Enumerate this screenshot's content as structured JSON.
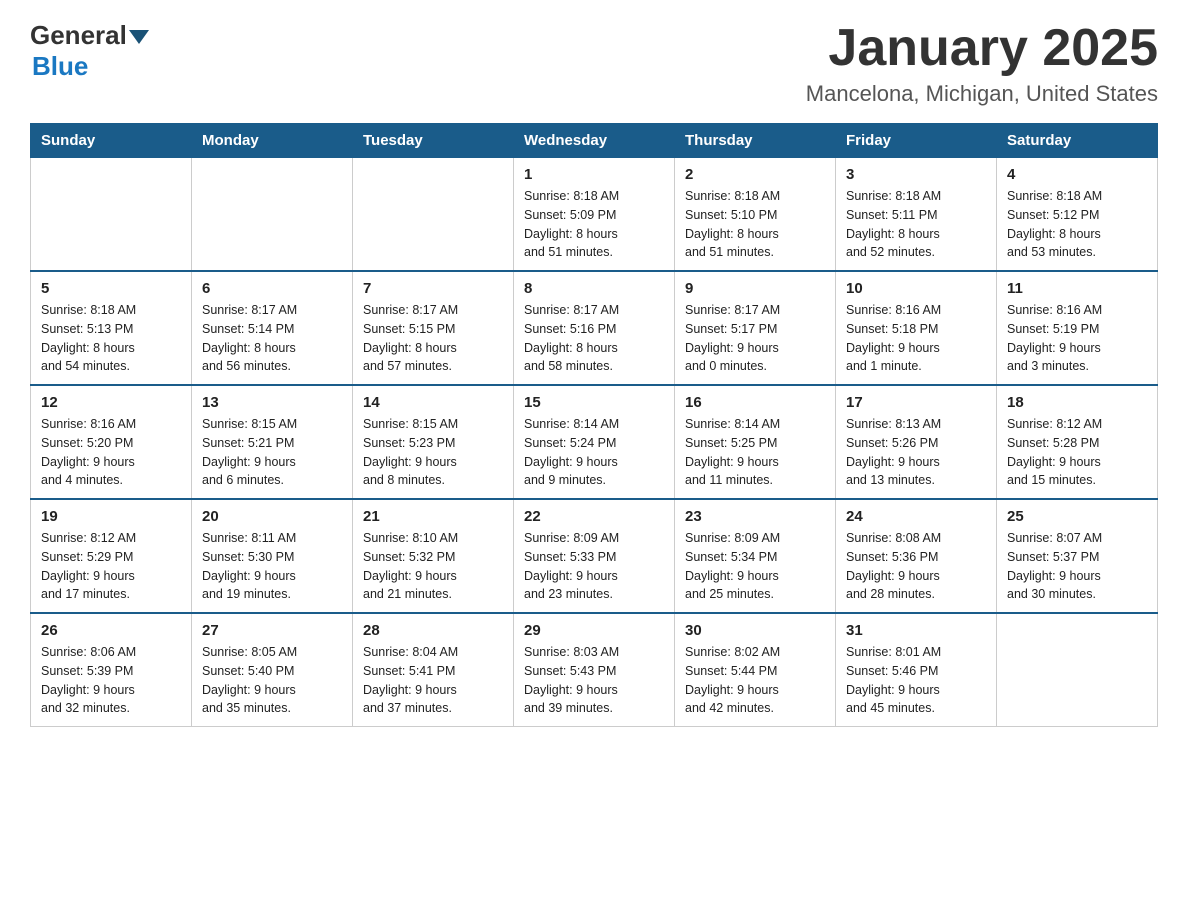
{
  "header": {
    "logo": {
      "text_general": "General",
      "text_blue": "Blue"
    },
    "title": "January 2025",
    "location": "Mancelona, Michigan, United States"
  },
  "calendar": {
    "days_of_week": [
      "Sunday",
      "Monday",
      "Tuesday",
      "Wednesday",
      "Thursday",
      "Friday",
      "Saturday"
    ],
    "weeks": [
      [
        {
          "day": "",
          "info": ""
        },
        {
          "day": "",
          "info": ""
        },
        {
          "day": "",
          "info": ""
        },
        {
          "day": "1",
          "info": "Sunrise: 8:18 AM\nSunset: 5:09 PM\nDaylight: 8 hours\nand 51 minutes."
        },
        {
          "day": "2",
          "info": "Sunrise: 8:18 AM\nSunset: 5:10 PM\nDaylight: 8 hours\nand 51 minutes."
        },
        {
          "day": "3",
          "info": "Sunrise: 8:18 AM\nSunset: 5:11 PM\nDaylight: 8 hours\nand 52 minutes."
        },
        {
          "day": "4",
          "info": "Sunrise: 8:18 AM\nSunset: 5:12 PM\nDaylight: 8 hours\nand 53 minutes."
        }
      ],
      [
        {
          "day": "5",
          "info": "Sunrise: 8:18 AM\nSunset: 5:13 PM\nDaylight: 8 hours\nand 54 minutes."
        },
        {
          "day": "6",
          "info": "Sunrise: 8:17 AM\nSunset: 5:14 PM\nDaylight: 8 hours\nand 56 minutes."
        },
        {
          "day": "7",
          "info": "Sunrise: 8:17 AM\nSunset: 5:15 PM\nDaylight: 8 hours\nand 57 minutes."
        },
        {
          "day": "8",
          "info": "Sunrise: 8:17 AM\nSunset: 5:16 PM\nDaylight: 8 hours\nand 58 minutes."
        },
        {
          "day": "9",
          "info": "Sunrise: 8:17 AM\nSunset: 5:17 PM\nDaylight: 9 hours\nand 0 minutes."
        },
        {
          "day": "10",
          "info": "Sunrise: 8:16 AM\nSunset: 5:18 PM\nDaylight: 9 hours\nand 1 minute."
        },
        {
          "day": "11",
          "info": "Sunrise: 8:16 AM\nSunset: 5:19 PM\nDaylight: 9 hours\nand 3 minutes."
        }
      ],
      [
        {
          "day": "12",
          "info": "Sunrise: 8:16 AM\nSunset: 5:20 PM\nDaylight: 9 hours\nand 4 minutes."
        },
        {
          "day": "13",
          "info": "Sunrise: 8:15 AM\nSunset: 5:21 PM\nDaylight: 9 hours\nand 6 minutes."
        },
        {
          "day": "14",
          "info": "Sunrise: 8:15 AM\nSunset: 5:23 PM\nDaylight: 9 hours\nand 8 minutes."
        },
        {
          "day": "15",
          "info": "Sunrise: 8:14 AM\nSunset: 5:24 PM\nDaylight: 9 hours\nand 9 minutes."
        },
        {
          "day": "16",
          "info": "Sunrise: 8:14 AM\nSunset: 5:25 PM\nDaylight: 9 hours\nand 11 minutes."
        },
        {
          "day": "17",
          "info": "Sunrise: 8:13 AM\nSunset: 5:26 PM\nDaylight: 9 hours\nand 13 minutes."
        },
        {
          "day": "18",
          "info": "Sunrise: 8:12 AM\nSunset: 5:28 PM\nDaylight: 9 hours\nand 15 minutes."
        }
      ],
      [
        {
          "day": "19",
          "info": "Sunrise: 8:12 AM\nSunset: 5:29 PM\nDaylight: 9 hours\nand 17 minutes."
        },
        {
          "day": "20",
          "info": "Sunrise: 8:11 AM\nSunset: 5:30 PM\nDaylight: 9 hours\nand 19 minutes."
        },
        {
          "day": "21",
          "info": "Sunrise: 8:10 AM\nSunset: 5:32 PM\nDaylight: 9 hours\nand 21 minutes."
        },
        {
          "day": "22",
          "info": "Sunrise: 8:09 AM\nSunset: 5:33 PM\nDaylight: 9 hours\nand 23 minutes."
        },
        {
          "day": "23",
          "info": "Sunrise: 8:09 AM\nSunset: 5:34 PM\nDaylight: 9 hours\nand 25 minutes."
        },
        {
          "day": "24",
          "info": "Sunrise: 8:08 AM\nSunset: 5:36 PM\nDaylight: 9 hours\nand 28 minutes."
        },
        {
          "day": "25",
          "info": "Sunrise: 8:07 AM\nSunset: 5:37 PM\nDaylight: 9 hours\nand 30 minutes."
        }
      ],
      [
        {
          "day": "26",
          "info": "Sunrise: 8:06 AM\nSunset: 5:39 PM\nDaylight: 9 hours\nand 32 minutes."
        },
        {
          "day": "27",
          "info": "Sunrise: 8:05 AM\nSunset: 5:40 PM\nDaylight: 9 hours\nand 35 minutes."
        },
        {
          "day": "28",
          "info": "Sunrise: 8:04 AM\nSunset: 5:41 PM\nDaylight: 9 hours\nand 37 minutes."
        },
        {
          "day": "29",
          "info": "Sunrise: 8:03 AM\nSunset: 5:43 PM\nDaylight: 9 hours\nand 39 minutes."
        },
        {
          "day": "30",
          "info": "Sunrise: 8:02 AM\nSunset: 5:44 PM\nDaylight: 9 hours\nand 42 minutes."
        },
        {
          "day": "31",
          "info": "Sunrise: 8:01 AM\nSunset: 5:46 PM\nDaylight: 9 hours\nand 45 minutes."
        },
        {
          "day": "",
          "info": ""
        }
      ]
    ]
  }
}
